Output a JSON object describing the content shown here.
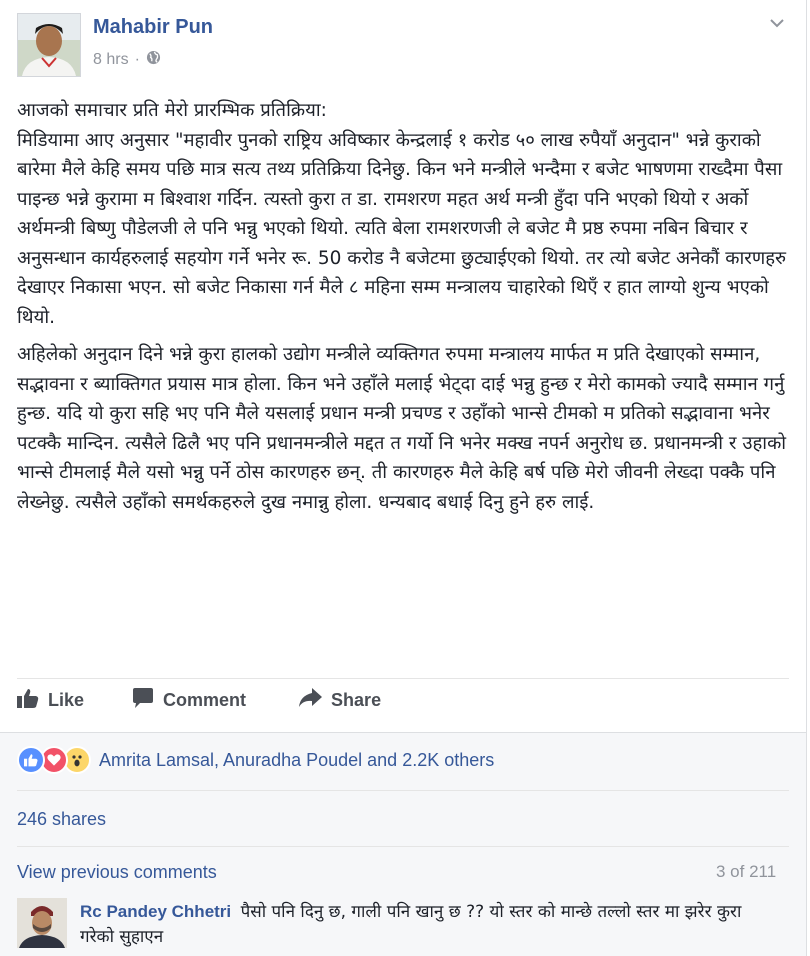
{
  "post": {
    "author": "Mahabir Pun",
    "time": "8 hrs",
    "separator": "·",
    "paragraph1": "आजको समाचार प्रति मेरो प्रारम्भिक प्रतिक्रिया:\nमिडियामा आए अनुसार \"महावीर पुनको राष्ट्रिय अविष्कार केन्द्रलाई १ करोड ५० लाख रुपैयाँ अनुदान\" भन्ने कुराको बारेमा मैले केहि समय पछि मात्र सत्य तथ्य प्रतिक्रिया दिनेछु. किन भने मन्त्रीले भन्दैमा र बजेट भाषणमा राख्दैमा पैसा पाइन्छ भन्ने कुरामा म बिश्वाश गर्दिन. त्यस्तो कुरा त डा. रामशरण महत अर्थ मन्त्री हुँदा पनि भएको थियो र अर्को अर्थमन्त्री बिष्णु पौडेलजी ले पनि भन्नु भएको थियो. त्यति बेला रामशरणजी ले बजेट मै प्रष्ठ रुपमा नबिन बिचार र अनुसन्धान कार्यहरुलाई सहयोग गर्ने भनेर रू. 50 करोड नै बजेटमा छुट्याईएको थियो. तर त्यो बजेट अनेकौं कारणहरु देखाएर निकासा भएन. सो बजेट निकासा गर्न मैले ८ महिना सम्म मन्त्रालय चाहारेको थिएँ र हात लाग्यो शुन्य भएको थियो.",
    "paragraph2": "अहिलेको अनुदान दिने भन्ने कुरा हालको उद्योग मन्त्रीले व्यक्तिगत रुपमा मन्त्रालय मार्फत म प्रति देखाएको सम्मान, सद्भावना र ब्याक्तिगत प्रयास मात्र होला. किन भने उहाँले मलाई भेट्दा दाई भन्नु हुन्छ र मेरो कामको ज्यादै सम्मान गर्नु हुन्छ. यदि यो कुरा सहि भए पनि मैले यसलाई प्रधान मन्त्री प्रचण्ड र उहाँको भान्से टीमको म प्रतिको सद्भावाना भनेर पटक्कै मान्दिन. त्यसैले ढिलै भए पनि प्रधानमन्त्रीले मद्दत त गर्यो नि भनेर मक्ख नपर्न अनुरोध छ. प्रधानमन्त्री र उहाको भान्से टीमलाई मैले यसो भन्नु पर्ने ठोस कारणहरु छन्. ती कारणहरु मैले केहि बर्ष पछि मेरो जीवनी लेख्दा पक्कै पनि लेख्नेछु. त्यसैले उहाँको समर्थकहरुले दुख नमान्नु होला. धन्यबाद बधाई दिनु हुने हरु लाई."
  },
  "actions": {
    "like": "Like",
    "comment": "Comment",
    "share": "Share"
  },
  "reactions": {
    "text": "Amrita Lamsal, Anuradha Poudel and 2.2K others"
  },
  "shares": "246 shares",
  "comments": {
    "view_previous": "View previous comments",
    "count": "3 of 211",
    "items": [
      {
        "name": "Rc Pandey Chhetri",
        "text": "पैसो पनि दिनु छ, गाली पनि खानु छ ?? यो स्तर को मान्छे तल्लो स्तर मा झरेर कुरा गरेको सुहाएन"
      }
    ]
  },
  "colors": {
    "link": "#365899",
    "secondary_text": "#90949c",
    "like_blue": "#5890ff",
    "love_red": "#f25268",
    "wow_yellow": "#fcd669"
  },
  "icons": [
    "globe-icon",
    "chevron-down-icon",
    "like-icon",
    "comment-icon",
    "share-icon"
  ]
}
